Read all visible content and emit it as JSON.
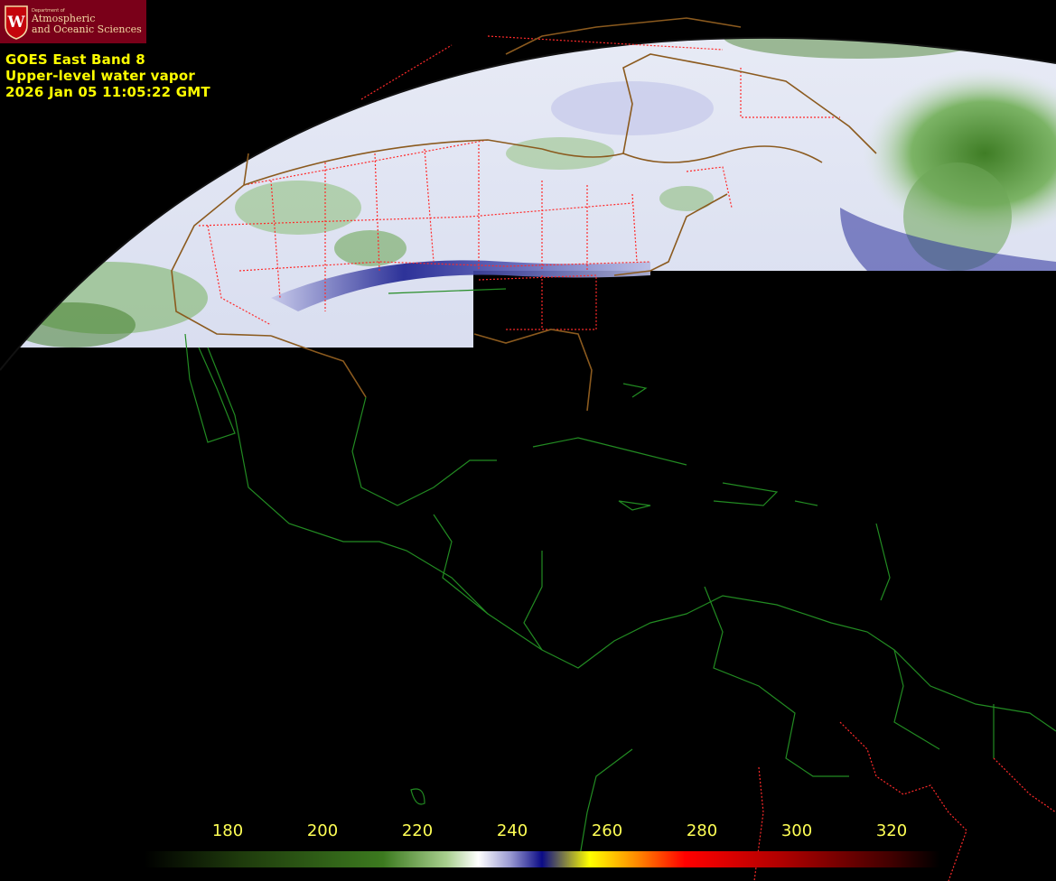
{
  "logo": {
    "department": "Department of",
    "name_line1": "Atmospheric",
    "name_line2": "and Oceanic Sciences",
    "shield_letter": "W"
  },
  "caption": {
    "line1": "GOES East Band 8",
    "line2": "Upper-level water vapor",
    "line3": "2026 Jan 05  11:05:22 GMT"
  },
  "colorbar": {
    "ticks": [
      "180",
      "200",
      "220",
      "240",
      "260",
      "280",
      "300",
      "320"
    ],
    "stops": [
      [
        "#000000",
        0
      ],
      [
        "#1e3a0c",
        0.12
      ],
      [
        "#3c7a1f",
        0.3
      ],
      [
        "#a8cf8e",
        0.38
      ],
      [
        "#ffffff",
        0.42
      ],
      [
        "#9a9ad2",
        0.46
      ],
      [
        "#0b0b86",
        0.5
      ],
      [
        "#ffff00",
        0.56
      ],
      [
        "#ff8800",
        0.62
      ],
      [
        "#ff0000",
        0.68
      ],
      [
        "#b00000",
        0.8
      ],
      [
        "#400000",
        0.94
      ],
      [
        "#000000",
        1
      ]
    ]
  },
  "colors": {
    "state_borders": "#ff2a2a",
    "country_borders": "#228b22",
    "coastline_north": "#8b5a1e",
    "label_yellow": "#ffff00"
  }
}
